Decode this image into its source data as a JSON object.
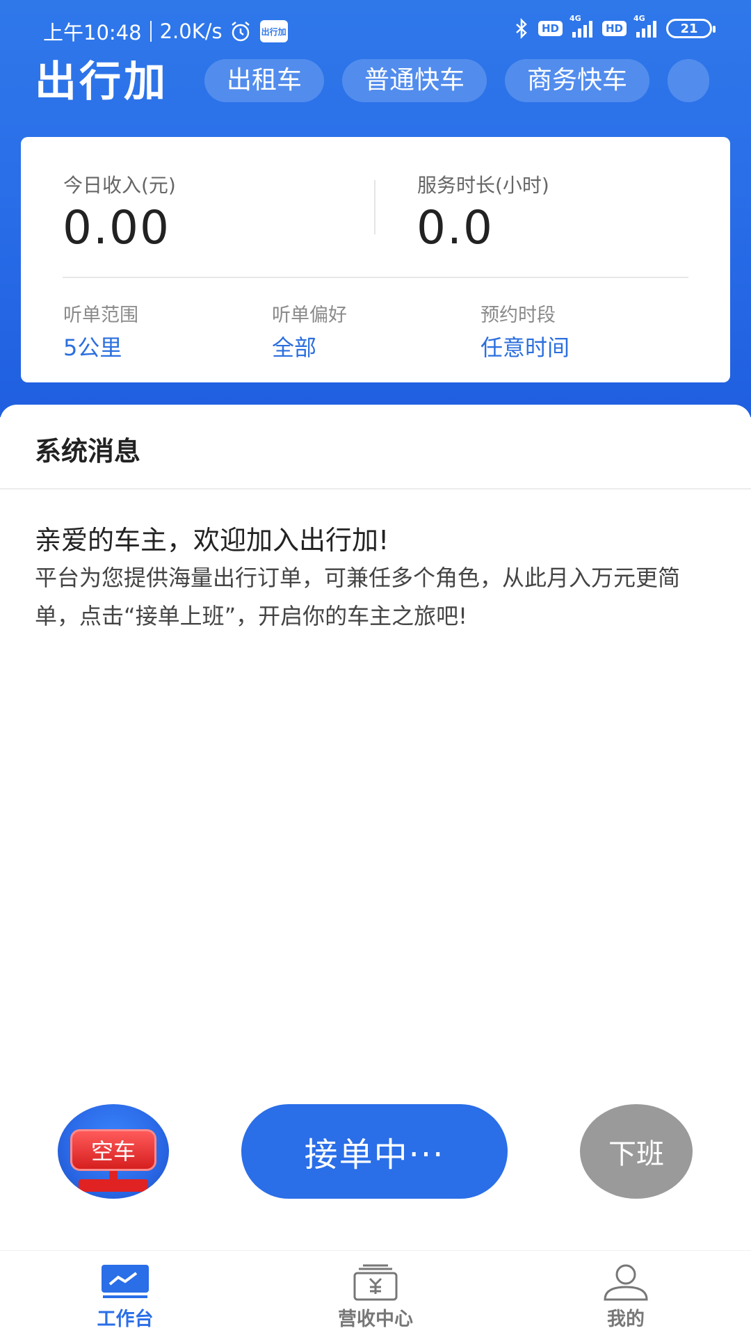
{
  "status_bar": {
    "time": "上午10:48",
    "speed": "2.0K/s",
    "app_badge": "出行加",
    "hd1": "HD",
    "net1": "4G",
    "hd2": "HD",
    "net2": "4G",
    "battery": "21"
  },
  "header": {
    "brand": "出行加",
    "tabs": [
      {
        "label": "出租车"
      },
      {
        "label": "普通快车"
      },
      {
        "label": "商务快车"
      },
      {
        "label": ""
      }
    ]
  },
  "stats": {
    "income_label": "今日收入(元)",
    "income_value": "0.00",
    "duration_label": "服务时长(小时)",
    "duration_value": "0.0"
  },
  "preferences": {
    "range_label": "听单范围",
    "range_value": "5公里",
    "pref_label": "听单偏好",
    "pref_value": "全部",
    "slot_label": "预约时段",
    "slot_value": "任意时间"
  },
  "messages": {
    "section_title": "系统消息",
    "title": "亲爱的车主，欢迎加入出行加!",
    "body": "平台为您提供海量出行订单，可兼任多个角色，从此月入万元更简单，点击“接单上班”，开启你的车主之旅吧!"
  },
  "actions": {
    "empty_label": "空车",
    "accept_label": "接单中···",
    "offwork_label": "下班"
  },
  "bottom_nav": {
    "items": [
      {
        "label": "工作台",
        "icon": "workbench-icon",
        "active": true
      },
      {
        "label": "营收中心",
        "icon": "revenue-icon",
        "active": false
      },
      {
        "label": "我的",
        "icon": "profile-icon",
        "active": false
      }
    ]
  },
  "colors": {
    "primary": "#2a6ee8",
    "link": "#2b6fde",
    "danger": "#e02222",
    "disabled": "#9a9a9a"
  }
}
